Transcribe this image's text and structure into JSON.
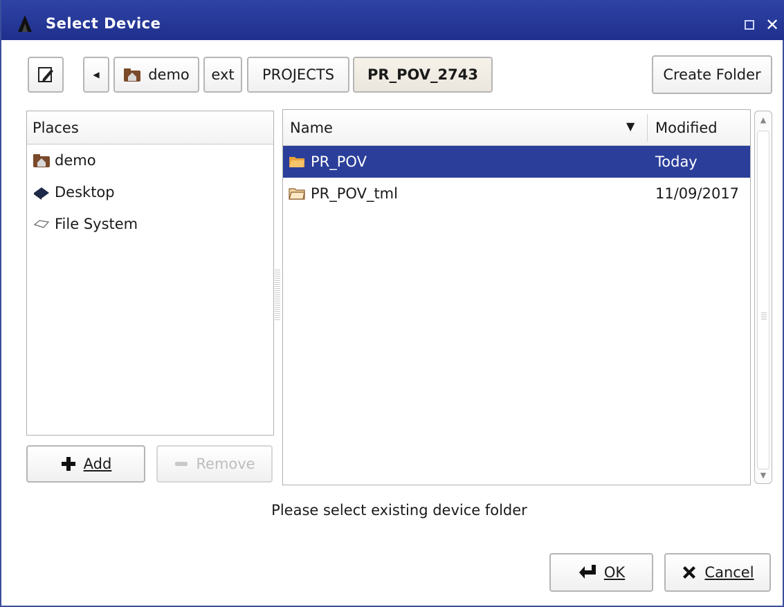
{
  "window": {
    "title": "Select Device",
    "accent": "#2b3e9a"
  },
  "toolbar": {
    "breadcrumbs": [
      "demo",
      "ext",
      "PROJECTS",
      "PR_POV_2743"
    ],
    "create_folder_label": "Create Folder"
  },
  "places": {
    "header": "Places",
    "items": [
      {
        "label": "demo",
        "icon": "home-folder-icon"
      },
      {
        "label": "Desktop",
        "icon": "desktop-icon"
      },
      {
        "label": "File System",
        "icon": "drive-icon"
      }
    ],
    "add_label": "Add",
    "remove_label": "Remove"
  },
  "files": {
    "columns": {
      "name": "Name",
      "modified": "Modified"
    },
    "rows": [
      {
        "name": "PR_POV",
        "modified": "Today",
        "selected": true
      },
      {
        "name": "PR_POV_tml",
        "modified": "11/09/2017",
        "selected": false
      }
    ]
  },
  "status": "Please select existing device folder",
  "dialog": {
    "ok_label": "OK",
    "cancel_label": "Cancel"
  }
}
